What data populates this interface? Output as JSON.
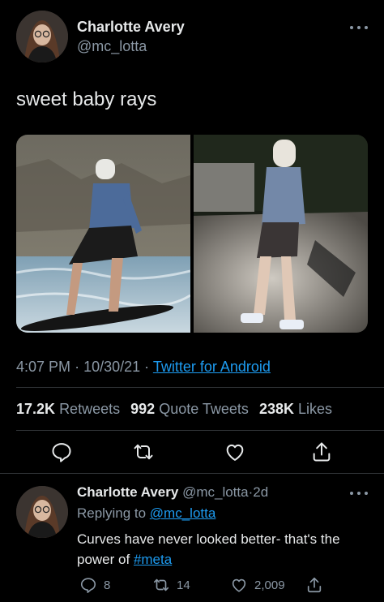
{
  "tweet": {
    "author_name": "Charlotte Avery",
    "author_handle": "@mc_lotta",
    "text": "sweet baby rays",
    "time": "4:07 PM",
    "separator1": "·",
    "date": "10/30/21",
    "separator2": "·",
    "source": "Twitter for Android",
    "stats": {
      "retweets_count": "17.2K",
      "retweets_label": "Retweets",
      "quotes_count": "992",
      "quotes_label": "Quote Tweets",
      "likes_count": "238K",
      "likes_label": "Likes"
    }
  },
  "reply": {
    "author_name": "Charlotte Avery",
    "author_handle": "@mc_lotta",
    "separator": "·",
    "age": "2d",
    "replying_prefix": "Replying to",
    "replying_to": "@mc_lotta",
    "text": "Curves have never looked better- that's the power of",
    "hashtag": "#meta",
    "counts": {
      "replies": "8",
      "retweets": "14",
      "likes": "2,009"
    }
  },
  "colors": {
    "background": "#000000",
    "text_primary": "#e7e9ea",
    "text_secondary": "#8b98a5",
    "link": "#1d9bf0",
    "divider": "#2f3336"
  },
  "icons": {
    "reply": "speech-bubble-icon",
    "retweet": "retweet-arrows-icon",
    "like": "heart-icon",
    "share": "share-upload-icon",
    "more": "three-dots-icon"
  }
}
